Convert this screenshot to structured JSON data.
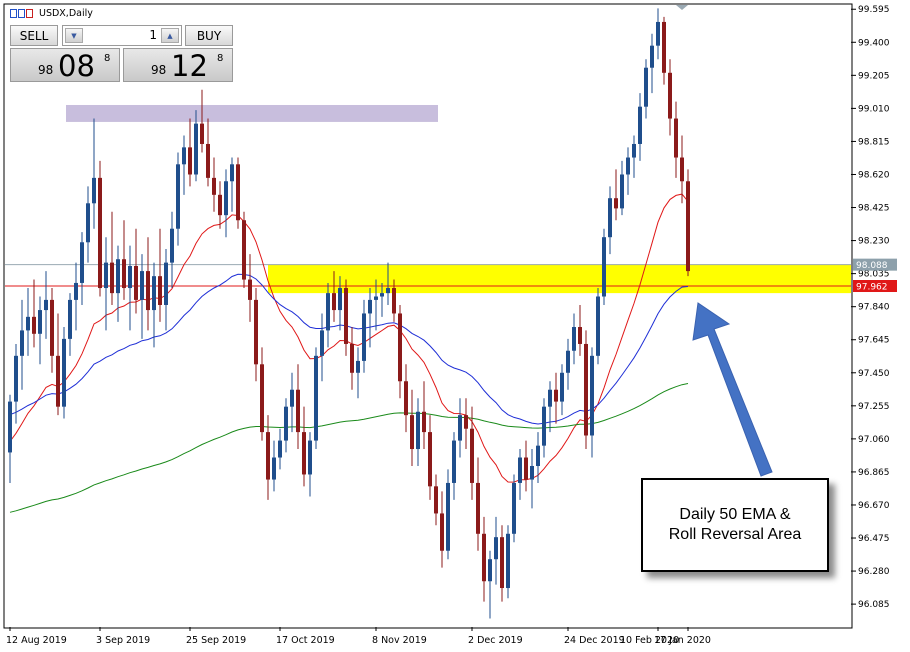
{
  "window": {
    "symbol_title": "USDX,Daily"
  },
  "trade_panel": {
    "sell_label": "SELL",
    "buy_label": "BUY",
    "lot_value": "1",
    "sell_price": {
      "prefix": "98",
      "big": "08",
      "sup": "8"
    },
    "buy_price": {
      "prefix": "98",
      "big": "12",
      "sup": "8"
    }
  },
  "annotation": {
    "line1": "Daily 50 EMA &",
    "line2": "Roll Reversal Area"
  },
  "colors": {
    "up_candle": "#1f4e8c",
    "down_candle": "#8b1a1a",
    "ema_red": "#e01818",
    "ema_blue": "#1f2fd6",
    "ema_green": "#1a8a1a",
    "highlight_yellow": "#ffff00",
    "resistance_zone": "#c8bedd",
    "arrow": "#4472c4",
    "current_price_bg": "#e01818",
    "bid_price_bg": "#8da0ab"
  },
  "chart_data": {
    "type": "candlestick",
    "symbol": "USDX",
    "timeframe": "Daily",
    "ylim": [
      95.95,
      99.62
    ],
    "y_ticks": [
      "99.595",
      "99.400",
      "99.205",
      "99.010",
      "98.815",
      "98.620",
      "98.425",
      "98.230",
      "98.035",
      "97.840",
      "97.645",
      "97.450",
      "97.255",
      "97.060",
      "96.865",
      "96.670",
      "96.475",
      "96.280",
      "96.085"
    ],
    "x_ticks": [
      "12 Aug 2019",
      "3 Sep 2019",
      "25 Sep 2019",
      "17 Oct 2019",
      "8 Nov 2019",
      "2 Dec 2019",
      "24 Dec 2019",
      "17 Jan 2020",
      "10 Feb 2020"
    ],
    "price_labels": {
      "bid": "98.088",
      "last": "97.962"
    },
    "zones": [
      {
        "name": "resistance",
        "low": 98.93,
        "high": 99.03
      },
      {
        "name": "roll-reversal",
        "low": 97.92,
        "high": 98.09
      }
    ],
    "candles": [
      [
        96.98,
        97.32,
        96.8,
        97.28
      ],
      [
        97.28,
        97.62,
        97.15,
        97.55
      ],
      [
        97.55,
        97.88,
        97.35,
        97.7
      ],
      [
        97.7,
        97.95,
        97.55,
        97.78
      ],
      [
        97.78,
        98.0,
        97.6,
        97.68
      ],
      [
        97.68,
        97.9,
        97.5,
        97.82
      ],
      [
        97.82,
        98.05,
        97.65,
        97.88
      ],
      [
        97.88,
        97.95,
        97.45,
        97.55
      ],
      [
        97.55,
        97.8,
        97.2,
        97.25
      ],
      [
        97.25,
        97.72,
        97.18,
        97.65
      ],
      [
        97.65,
        97.92,
        97.55,
        97.88
      ],
      [
        97.88,
        98.1,
        97.7,
        97.98
      ],
      [
        97.98,
        98.28,
        97.85,
        98.22
      ],
      [
        98.22,
        98.55,
        98.1,
        98.45
      ],
      [
        98.45,
        98.95,
        98.3,
        98.6
      ],
      [
        98.6,
        98.7,
        97.9,
        97.95
      ],
      [
        97.95,
        98.25,
        97.7,
        98.1
      ],
      [
        98.1,
        98.4,
        97.85,
        97.92
      ],
      [
        97.92,
        98.2,
        97.75,
        98.12
      ],
      [
        98.12,
        98.35,
        97.88,
        97.95
      ],
      [
        97.95,
        98.2,
        97.7,
        98.08
      ],
      [
        98.08,
        98.3,
        97.8,
        97.88
      ],
      [
        97.88,
        98.15,
        97.65,
        98.05
      ],
      [
        98.05,
        98.25,
        97.7,
        97.82
      ],
      [
        97.82,
        98.1,
        97.6,
        98.02
      ],
      [
        98.02,
        98.3,
        97.75,
        97.85
      ],
      [
        97.85,
        98.18,
        97.7,
        98.1
      ],
      [
        98.1,
        98.4,
        97.95,
        98.3
      ],
      [
        98.3,
        98.75,
        98.2,
        98.68
      ],
      [
        98.68,
        98.85,
        98.5,
        98.78
      ],
      [
        98.78,
        98.95,
        98.55,
        98.62
      ],
      [
        98.62,
        99.0,
        98.58,
        98.92
      ],
      [
        98.92,
        99.12,
        98.75,
        98.8
      ],
      [
        98.8,
        98.95,
        98.55,
        98.6
      ],
      [
        98.6,
        98.72,
        98.4,
        98.5
      ],
      [
        98.5,
        98.58,
        98.3,
        98.38
      ],
      [
        98.38,
        98.65,
        98.25,
        98.58
      ],
      [
        98.58,
        98.72,
        98.4,
        98.68
      ],
      [
        98.68,
        98.72,
        98.3,
        98.35
      ],
      [
        98.35,
        98.4,
        97.95,
        98.0
      ],
      [
        98.0,
        98.15,
        97.75,
        97.88
      ],
      [
        97.88,
        97.95,
        97.4,
        97.5
      ],
      [
        97.5,
        97.6,
        97.05,
        97.1
      ],
      [
        97.1,
        97.2,
        96.7,
        96.82
      ],
      [
        96.82,
        97.05,
        96.75,
        96.95
      ],
      [
        96.95,
        97.12,
        96.88,
        97.05
      ],
      [
        97.05,
        97.3,
        96.98,
        97.25
      ],
      [
        97.25,
        97.45,
        97.1,
        97.35
      ],
      [
        97.35,
        97.5,
        97.0,
        97.1
      ],
      [
        97.1,
        97.25,
        96.78,
        96.85
      ],
      [
        96.85,
        97.1,
        96.72,
        97.05
      ],
      [
        97.05,
        97.6,
        97.0,
        97.55
      ],
      [
        97.55,
        97.8,
        97.4,
        97.7
      ],
      [
        97.7,
        97.98,
        97.6,
        97.92
      ],
      [
        97.92,
        98.05,
        97.75,
        97.82
      ],
      [
        97.82,
        98.02,
        97.7,
        97.95
      ],
      [
        97.95,
        98.0,
        97.55,
        97.62
      ],
      [
        97.62,
        97.72,
        97.35,
        97.45
      ],
      [
        97.45,
        97.6,
        97.3,
        97.52
      ],
      [
        97.52,
        97.88,
        97.45,
        97.8
      ],
      [
        97.8,
        97.95,
        97.6,
        97.88
      ],
      [
        97.88,
        98.0,
        97.7,
        97.9
      ],
      [
        97.9,
        97.98,
        97.78,
        97.92
      ],
      [
        97.92,
        98.1,
        97.85,
        97.95
      ],
      [
        97.95,
        98.0,
        97.75,
        97.8
      ],
      [
        97.8,
        97.85,
        97.3,
        97.4
      ],
      [
        97.4,
        97.5,
        97.1,
        97.2
      ],
      [
        97.2,
        97.35,
        96.9,
        97.0
      ],
      [
        97.0,
        97.3,
        96.9,
        97.22
      ],
      [
        97.22,
        97.4,
        97.0,
        97.1
      ],
      [
        97.1,
        97.2,
        96.7,
        96.78
      ],
      [
        96.78,
        96.85,
        96.55,
        96.62
      ],
      [
        96.62,
        96.75,
        96.3,
        96.4
      ],
      [
        96.4,
        96.88,
        96.35,
        96.8
      ],
      [
        96.8,
        97.1,
        96.7,
        97.05
      ],
      [
        97.05,
        97.3,
        96.95,
        97.2
      ],
      [
        97.2,
        97.3,
        97.0,
        97.12
      ],
      [
        97.12,
        97.25,
        96.7,
        96.8
      ],
      [
        96.8,
        96.95,
        96.4,
        96.5
      ],
      [
        96.5,
        96.6,
        96.1,
        96.22
      ],
      [
        96.22,
        96.4,
        96.0,
        96.35
      ],
      [
        96.35,
        96.6,
        96.2,
        96.48
      ],
      [
        96.48,
        96.55,
        96.1,
        96.18
      ],
      [
        96.18,
        96.55,
        96.12,
        96.5
      ],
      [
        96.5,
        96.85,
        96.45,
        96.8
      ],
      [
        96.8,
        97.0,
        96.7,
        96.95
      ],
      [
        96.95,
        97.05,
        96.75,
        96.82
      ],
      [
        96.82,
        97.0,
        96.65,
        96.9
      ],
      [
        96.9,
        97.1,
        96.8,
        97.02
      ],
      [
        97.02,
        97.3,
        96.95,
        97.25
      ],
      [
        97.25,
        97.4,
        97.1,
        97.35
      ],
      [
        97.35,
        97.45,
        97.15,
        97.28
      ],
      [
        97.28,
        97.5,
        97.2,
        97.45
      ],
      [
        97.45,
        97.65,
        97.35,
        97.58
      ],
      [
        97.58,
        97.8,
        97.5,
        97.72
      ],
      [
        97.72,
        97.85,
        97.55,
        97.62
      ],
      [
        97.62,
        97.7,
        97.0,
        97.08
      ],
      [
        97.08,
        97.6,
        96.95,
        97.55
      ],
      [
        97.55,
        97.95,
        97.5,
        97.9
      ],
      [
        97.9,
        98.3,
        97.85,
        98.25
      ],
      [
        98.25,
        98.55,
        98.15,
        98.48
      ],
      [
        98.48,
        98.65,
        98.35,
        98.42
      ],
      [
        98.42,
        98.7,
        98.38,
        98.62
      ],
      [
        98.62,
        98.78,
        98.5,
        98.72
      ],
      [
        98.72,
        98.85,
        98.6,
        98.8
      ],
      [
        98.8,
        99.1,
        98.7,
        99.02
      ],
      [
        99.02,
        99.3,
        98.95,
        99.25
      ],
      [
        99.25,
        99.45,
        99.1,
        99.38
      ],
      [
        99.38,
        99.6,
        99.3,
        99.52
      ],
      [
        99.52,
        99.55,
        99.15,
        99.22
      ],
      [
        99.22,
        99.3,
        98.85,
        98.95
      ],
      [
        98.95,
        99.05,
        98.6,
        98.72
      ],
      [
        98.72,
        98.85,
        98.45,
        98.58
      ],
      [
        98.58,
        98.65,
        98.02,
        98.05
      ]
    ]
  }
}
